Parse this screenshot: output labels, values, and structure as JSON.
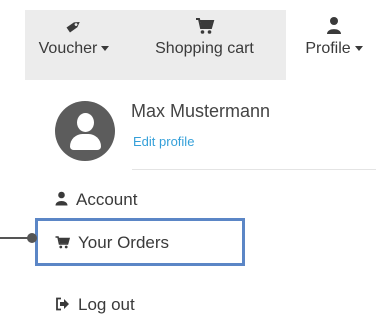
{
  "nav": {
    "voucher": {
      "label": "Voucher",
      "icon": "tag-icon",
      "has_dropdown": true
    },
    "cart": {
      "label": "Shopping cart",
      "icon": "shopping-cart-icon"
    },
    "profile": {
      "label": "Profile",
      "icon": "user-icon",
      "has_dropdown": true
    }
  },
  "profile_menu": {
    "user_name": "Max Mustermann",
    "edit_profile": "Edit profile",
    "items": [
      {
        "label": "Account",
        "icon": "user-icon"
      },
      {
        "label": "Your Orders",
        "icon": "shopping-cart-icon",
        "highlighted": true
      },
      {
        "label": "Log out",
        "icon": "sign-out-icon"
      }
    ]
  },
  "colors": {
    "link": "#35a0d9",
    "highlight_border": "#5b86c6",
    "nav_background": "#ececec",
    "avatar": "#5c5c5c"
  }
}
